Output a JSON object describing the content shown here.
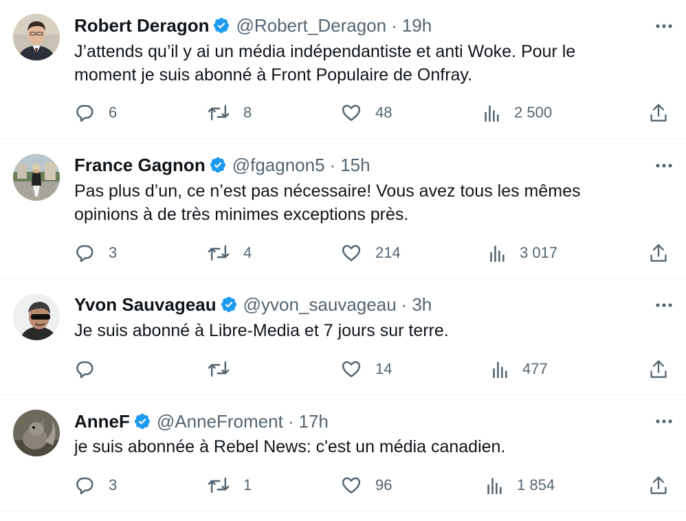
{
  "colors": {
    "text": "#0f1419",
    "secondary": "#536471",
    "verified": "#1d9bf0",
    "divider": "#eff3f4"
  },
  "tweets": [
    {
      "name": "Robert Deragon",
      "handle": "@Robert_Deragon",
      "separator": "·",
      "time": "19h",
      "text_lines": [
        "J’attends qu’il y ai un média indépendantiste et anti Woke. Pour le",
        "moment je suis abonné à Front Populaire de Onfray."
      ],
      "replies": "6",
      "retweets": "8",
      "likes": "48",
      "views": "2 500"
    },
    {
      "name": "France Gagnon",
      "handle": "@fgagnon5",
      "separator": "·",
      "time": "15h",
      "text_lines": [
        "Pas plus d’un, ce n’est pas nécessaire! Vous avez tous les mêmes",
        "opinions à de très minimes exceptions près."
      ],
      "replies": "3",
      "retweets": "4",
      "likes": "214",
      "views": "3 017"
    },
    {
      "name": "Yvon Sauvageau",
      "handle": "@yvon_sauvageau",
      "separator": "·",
      "time": "3h",
      "text_lines": [
        "Je suis abonné à Libre-Media et 7 jours sur terre."
      ],
      "replies": "",
      "retweets": "",
      "likes": "14",
      "views": "477"
    },
    {
      "name": "AnneF",
      "handle": "@AnneFroment",
      "separator": "·",
      "time": "17h",
      "text_lines": [
        "je suis abonnée à Rebel News: c'est un média canadien."
      ],
      "replies": "3",
      "retweets": "1",
      "likes": "96",
      "views": "1 854"
    }
  ]
}
